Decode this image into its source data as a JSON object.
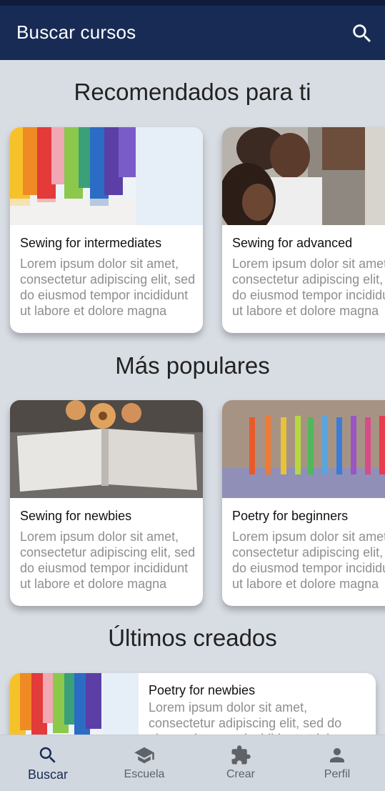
{
  "app_bar": {
    "title": "Buscar cursos",
    "search_icon": "search-icon"
  },
  "sections": {
    "recommended": {
      "title": "Recomendados para ti",
      "cards": [
        {
          "title": "Sewing for intermediates",
          "description": "Lorem ipsum dolor sit amet, consectetur adipiscing elit, sed do eiusmod tempor incididunt ut labore et dolore magna aliqua."
        },
        {
          "title": "Sewing for advanced",
          "description": "Lorem ipsum dolor sit amet, consectetur adipiscing elit, sed do eiusmod tempor incididunt ut labore et dolore magna aliqua."
        }
      ]
    },
    "popular": {
      "title": "Más populares",
      "cards": [
        {
          "title": "Sewing for newbies",
          "description": "Lorem ipsum dolor sit amet, consectetur adipiscing elit, sed do eiusmod tempor incididunt ut labore et dolore magna aliqua."
        },
        {
          "title": "Poetry for beginners",
          "description": "Lorem ipsum dolor sit amet, consectetur adipiscing elit, sed do eiusmod tempor incididunt ut labore et dolore magna aliqua."
        }
      ]
    },
    "latest": {
      "title": "Últimos creados",
      "cards": [
        {
          "title": "Poetry for newbies",
          "description": "Lorem ipsum dolor sit amet, consectetur adipiscing elit, sed do eiusmod tempor incididunt ut labore et dolore magna aliqua."
        }
      ]
    }
  },
  "bottom_nav": {
    "items": [
      {
        "label": "Buscar",
        "icon": "search-icon",
        "active": true
      },
      {
        "label": "Escuela",
        "icon": "school-icon",
        "active": false
      },
      {
        "label": "Crear",
        "icon": "puzzle-icon",
        "active": false
      },
      {
        "label": "Perfil",
        "icon": "person-icon",
        "active": false
      }
    ]
  },
  "colors": {
    "app_bar": "#172b55",
    "background": "#d8dde4",
    "active_nav": "#172b55",
    "inactive_nav": "#5f6368"
  }
}
